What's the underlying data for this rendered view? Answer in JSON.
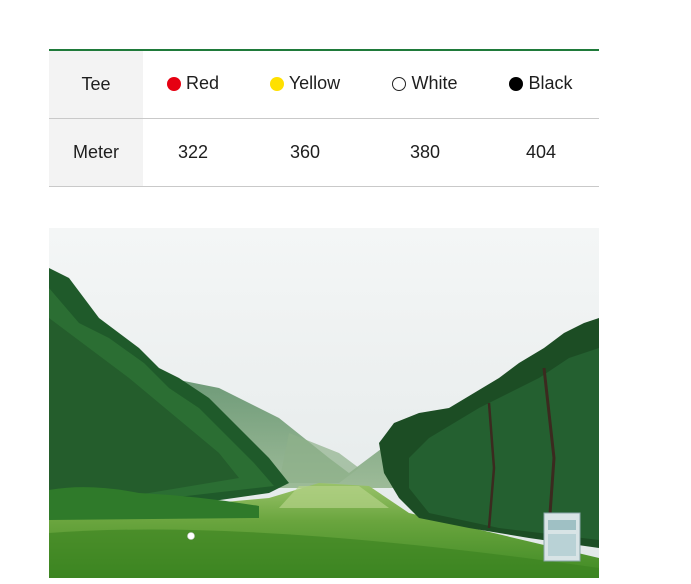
{
  "table": {
    "header_label": "Tee",
    "value_label": "Meter",
    "tees": [
      {
        "name": "Red",
        "color": "#e60012",
        "meter": "322"
      },
      {
        "name": "Yellow",
        "color": "#ffe000",
        "meter": "360"
      },
      {
        "name": "White",
        "color": "#ffffff",
        "meter": "380"
      },
      {
        "name": "Black",
        "color": "#000000",
        "meter": "404"
      }
    ],
    "accent_color": "#1f7a3a"
  },
  "photo": {
    "subject": "golf-course-hole-photo"
  }
}
